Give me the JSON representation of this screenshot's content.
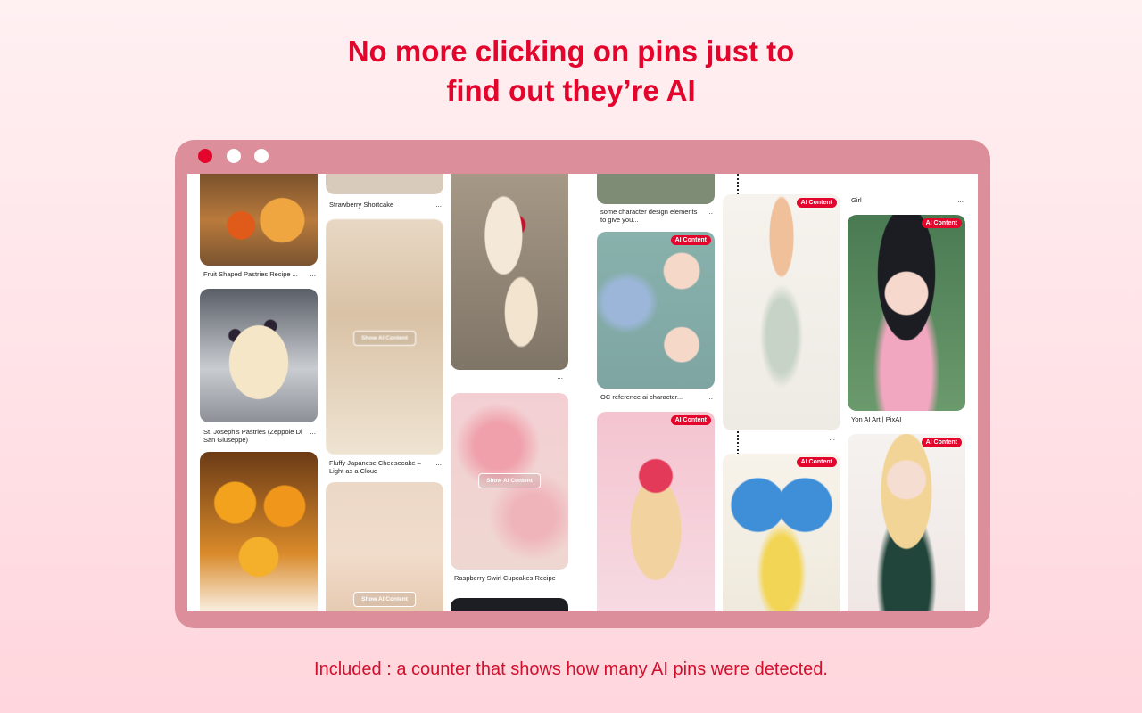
{
  "headline": {
    "line1": "No more clicking on pins just to",
    "line2": "find out they’re AI"
  },
  "footer": "Included : a counter that shows how many AI pins were detected.",
  "colors": {
    "accent": "#e3052c",
    "frame": "#dc8f9a",
    "background_top": "#fff0f2",
    "background_bottom": "#ffd6dd"
  },
  "window_controls": [
    "close-dot",
    "minimize-dot",
    "maximize-dot"
  ],
  "pins": {
    "col1": [
      {
        "caption": "Fruit Shaped Pastries Recipe ..."
      },
      {
        "caption": "St. Joseph's Pastries (Zeppole Di San Giuseppe)"
      },
      {
        "caption": ""
      }
    ],
    "col2": [
      {
        "caption": "Strawberry Shortcake"
      },
      {
        "caption": "Fluffy Japanese Cheesecake – Light as a Cloud",
        "overlay": "Show AI Content"
      },
      {
        "overlay": "Show AI Content"
      }
    ],
    "col3": [
      {
        "caption": ""
      },
      {
        "caption": "Raspberry Swirl Cupcakes Recipe",
        "overlay": "Show AI Content"
      }
    ],
    "col4": [
      {
        "caption": "some character design elements to give you..."
      },
      {
        "caption": "OC reference ai character...",
        "badge": "AI Content"
      },
      {
        "badge": "AI Content"
      }
    ],
    "col5": [
      {
        "badge": "AI Content"
      },
      {
        "badge": "AI Content"
      }
    ],
    "col6": [
      {
        "caption": "Girl"
      },
      {
        "caption": "Yon AI Art | PixAI",
        "badge": "AI Content"
      },
      {
        "badge": "AI Content"
      }
    ]
  },
  "more_glyph": "..."
}
